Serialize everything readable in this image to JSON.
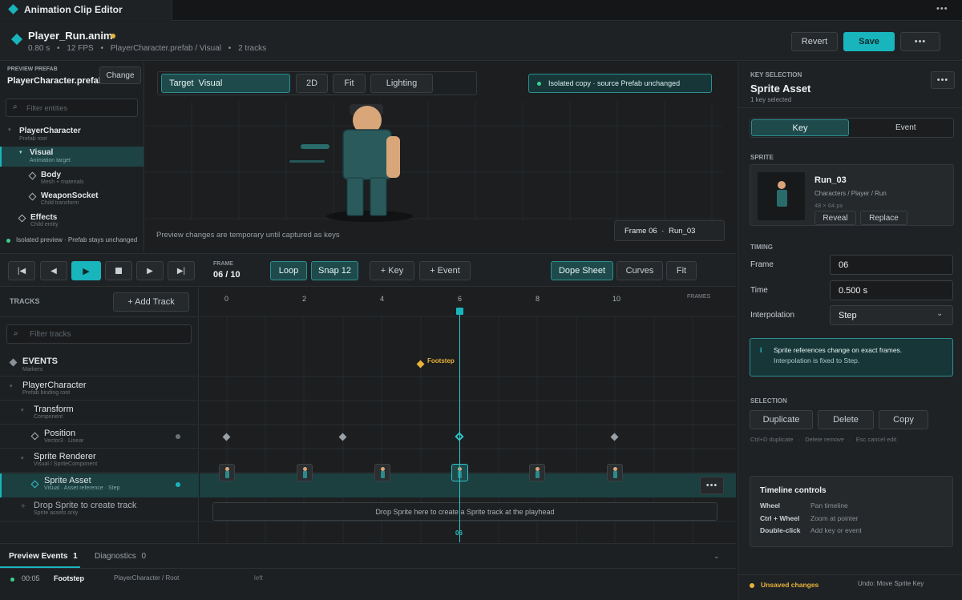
{
  "app": {
    "title": "Animation Clip Editor",
    "menu_label": "•••"
  },
  "file": {
    "name": "Player_Run.anim",
    "duration": "0.80 s",
    "fps": "12 FPS",
    "path": "PlayerCharacter.prefab / Visual",
    "tracks": "2 tracks",
    "sep": "•",
    "revert": "Revert",
    "save": "Save",
    "more": "•••"
  },
  "prefab": {
    "label": "PREVIEW PREFAB",
    "name": "PlayerCharacter.prefab",
    "change": "Change",
    "filter_placeholder": "Filter entities",
    "tree": [
      {
        "title": "PlayerCharacter",
        "sub": "Prefab root"
      },
      {
        "title": "Visual",
        "sub": "Animation target"
      },
      {
        "title": "Body",
        "sub": "Mesh + materials"
      },
      {
        "title": "WeaponSocket",
        "sub": "Child transform"
      },
      {
        "title": "Effects",
        "sub": "Child entity"
      }
    ],
    "footer": "Isolated preview · Prefab stays unchanged"
  },
  "viewport": {
    "target_label": "Target",
    "target_value": "Visual",
    "btn_2d": "2D",
    "btn_fit": "Fit",
    "btn_lighting": "Lighting",
    "isolated": "Isolated copy · source Prefab unchanged",
    "note": "Preview changes are temporary until captured as keys",
    "frame_label": "Frame 06",
    "frame_sep": "·",
    "frame_sprite": "Run_03"
  },
  "transport": {
    "frame_label": "FRAME",
    "frame_value": "06 / 10",
    "loop": "Loop",
    "snap": "Snap 12",
    "add_key": "+ Key",
    "add_event": "+ Event",
    "dope": "Dope Sheet",
    "curves": "Curves",
    "fit": "Fit"
  },
  "tracks": {
    "label": "TRACKS",
    "add": "+ Add Track",
    "filter_placeholder": "Filter tracks",
    "rows": [
      {
        "title": "EVENTS",
        "sub": "Markers"
      },
      {
        "title": "PlayerCharacter",
        "sub": "Prefab binding root"
      },
      {
        "title": "Transform",
        "sub": "Component"
      },
      {
        "title": "Position",
        "sub": "Vector3 · Linear"
      },
      {
        "title": "Sprite Renderer",
        "sub": "Visual / SpriteComponent"
      },
      {
        "title": "Sprite Asset",
        "sub": "Visual · Asset reference · Step"
      },
      {
        "title": "Drop Sprite to create track",
        "sub": "Sprite assets only"
      }
    ]
  },
  "timeline": {
    "ticks": [
      "0",
      "2",
      "4",
      "6",
      "8",
      "10"
    ],
    "frames_label": "FRAMES",
    "event_name": "Footstep",
    "drop_text": "Drop Sprite here to create a Sprite track at the playhead",
    "playhead_label": "06",
    "more": "•••"
  },
  "bottom": {
    "tab_events": "Preview Events",
    "tab_events_count": "1",
    "tab_diag": "Diagnostics",
    "tab_diag_count": "0",
    "row": {
      "time": "00:05",
      "name": "Footstep",
      "path": "PlayerCharacter / Root",
      "side": "left"
    }
  },
  "inspector": {
    "label": "KEY SELECTION",
    "title": "Sprite Asset",
    "sub": "1 key selected",
    "more": "•••",
    "tab_key": "Key",
    "tab_event": "Event",
    "sprite_label": "SPRITE",
    "sprite_name": "Run_03",
    "sprite_path": "Characters / Player / Run",
    "sprite_size": "48 × 64 px",
    "reveal": "Reveal",
    "replace": "Replace",
    "timing_label": "TIMING",
    "frame_label": "Frame",
    "frame_value": "06",
    "time_label": "Time",
    "time_value": "0.500 s",
    "interp_label": "Interpolation",
    "interp_value": "Step",
    "info_title": "Sprite references change on exact frames.",
    "info_body": "Interpolation is fixed to Step.",
    "selection_label": "SELECTION",
    "duplicate": "Duplicate",
    "delete": "Delete",
    "copy": "Copy",
    "hint1": "Ctrl+D duplicate",
    "hint2": "Delete remove",
    "hint3": "Esc cancel edit",
    "controls_title": "Timeline controls",
    "controls": [
      {
        "key": "Wheel",
        "desc": "Pan timeline"
      },
      {
        "key": "Ctrl + Wheel",
        "desc": "Zoom at pointer"
      },
      {
        "key": "Double-click",
        "desc": "Add key or event"
      }
    ],
    "unsaved": "Unsaved changes",
    "undo": "Undo: Move Sprite Key"
  },
  "colors": {
    "accent": "#19b5bd",
    "warning": "#e8b33b",
    "bg": "#1b1d1f"
  }
}
